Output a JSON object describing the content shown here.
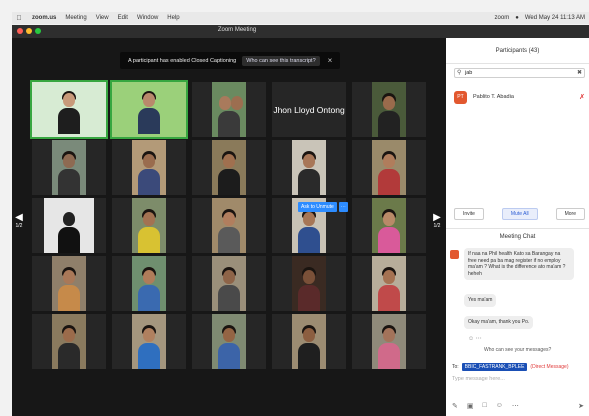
{
  "menubar": {
    "app": "zoom.us",
    "items": [
      "Meeting",
      "View",
      "Edit",
      "Window",
      "Help"
    ],
    "right_zoom": "zoom",
    "clock": "Wed May 24 11:13 AM"
  },
  "window": {
    "title": "Zoom Meeting"
  },
  "banner": {
    "text": "A participant has enabled Closed Captioning",
    "link": "Who can see this transcript?"
  },
  "tiles": {
    "named_participant": "Jhon Lloyd Ontong",
    "unmute_label": "Ask to Unmute",
    "page_left": "1/2",
    "page_right": "1/2"
  },
  "participants": {
    "title": "Participants (43)",
    "search_value": "jab",
    "row": {
      "initials": "PT",
      "name": "Pablito T. Abadia"
    },
    "invite": "Invite",
    "mute_all": "Mute All",
    "more": "More"
  },
  "chat": {
    "title": "Meeting Chat",
    "messages": [
      "If naa na Phil health Kato sa Barangay na free need pa ba mag register if no employ ma'am ? What is the difference ato ma'am ? heheh",
      "Yes ma'am",
      "Okay ma'am, thank you Po."
    ],
    "see_note": "Who can see your messages?",
    "to_label": "To:",
    "to_recipient": "BBIC_FASTRANK_BPLEE",
    "direct_label": "(Direct Message)",
    "placeholder": "Type message here..."
  },
  "colors": {
    "accent": "#2d8cff",
    "video_bg": "#171717",
    "active_speaker": "#37a640"
  }
}
